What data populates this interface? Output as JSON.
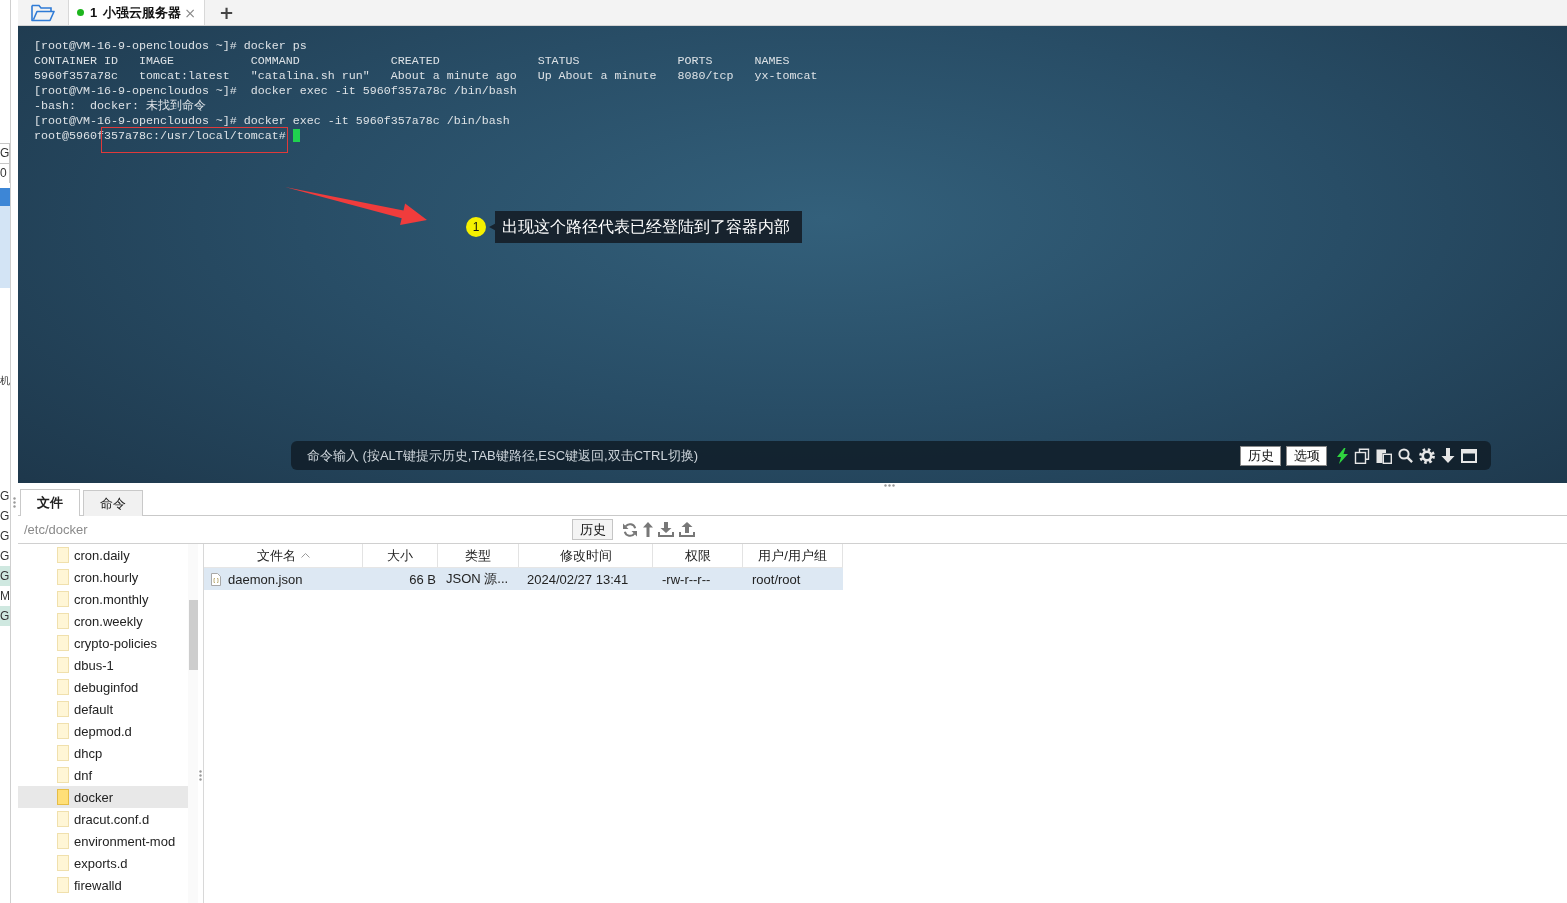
{
  "background_window": {
    "upper_labels": [
      {
        "text": "G",
        "highlighted": false
      },
      {
        "text": "0",
        "highlighted": false
      }
    ],
    "side_label": "机",
    "lower_labels": [
      {
        "text": "G",
        "highlighted": false
      },
      {
        "text": "G",
        "highlighted": false
      },
      {
        "text": "G",
        "highlighted": false
      },
      {
        "text": "G",
        "highlighted": false
      },
      {
        "text": "G",
        "highlighted": true
      },
      {
        "text": "M",
        "highlighted": false
      },
      {
        "text": "G",
        "highlighted": true
      }
    ]
  },
  "session_tabs": [
    {
      "number": "1",
      "title": "小强云服务器",
      "connected": true,
      "selected": true,
      "close": "×"
    }
  ],
  "new_tab": "+",
  "terminal": {
    "lines": [
      "[root@VM-16-9-opencloudos ~]# docker ps",
      "CONTAINER ID   IMAGE           COMMAND             CREATED              STATUS              PORTS      NAMES",
      "5960f357a78c   tomcat:latest   \"catalina.sh run\"   About a minute ago   Up About a minute   8080/tcp   yx-tomcat",
      "[root@VM-16-9-opencloudos ~]#  docker exec -it 5960f357a78c /bin/bash",
      "-bash:  docker: 未找到命令",
      "[root@VM-16-9-opencloudos ~]# docker exec -it 5960f357a78c /bin/bash",
      "root@5960f357a78c:/usr/local/tomcat#"
    ],
    "cursor": true
  },
  "annotation": {
    "step": "1",
    "text": "出现这个路径代表已经登陆到了容器内部"
  },
  "command_bar": {
    "placeholder": "命令输入 (按ALT键提示历史,TAB键路径,ESC键返回,双击CTRL切换)",
    "buttons": [
      "历史",
      "选项"
    ]
  },
  "file_panel": {
    "tabs": [
      {
        "label": "文件",
        "selected": true
      },
      {
        "label": "命令",
        "selected": false
      }
    ],
    "path": "/etc/docker",
    "history_button": "历史",
    "tree": [
      {
        "name": "cron.daily",
        "selected": false
      },
      {
        "name": "cron.hourly",
        "selected": false
      },
      {
        "name": "cron.monthly",
        "selected": false
      },
      {
        "name": "cron.weekly",
        "selected": false
      },
      {
        "name": "crypto-policies",
        "selected": false
      },
      {
        "name": "dbus-1",
        "selected": false
      },
      {
        "name": "debuginfod",
        "selected": false
      },
      {
        "name": "default",
        "selected": false
      },
      {
        "name": "depmod.d",
        "selected": false
      },
      {
        "name": "dhcp",
        "selected": false
      },
      {
        "name": "dnf",
        "selected": false
      },
      {
        "name": "docker",
        "selected": true
      },
      {
        "name": "dracut.conf.d",
        "selected": false
      },
      {
        "name": "environment-mod",
        "selected": false
      },
      {
        "name": "exports.d",
        "selected": false
      },
      {
        "name": "firewalld",
        "selected": false
      }
    ],
    "table": {
      "columns": [
        {
          "label": "文件名",
          "sorted": true
        },
        {
          "label": "大小",
          "sorted": false
        },
        {
          "label": "类型",
          "sorted": false
        },
        {
          "label": "修改时间",
          "sorted": false
        },
        {
          "label": "权限",
          "sorted": false
        },
        {
          "label": "用户/用户组",
          "sorted": false
        }
      ],
      "rows": [
        {
          "name": "daemon.json",
          "size": "66 B",
          "type": "JSON 源...",
          "modified": "2024/02/27 13:41",
          "permissions": "-rw-r--r--",
          "owner": "root/root",
          "selected": true
        }
      ]
    }
  }
}
